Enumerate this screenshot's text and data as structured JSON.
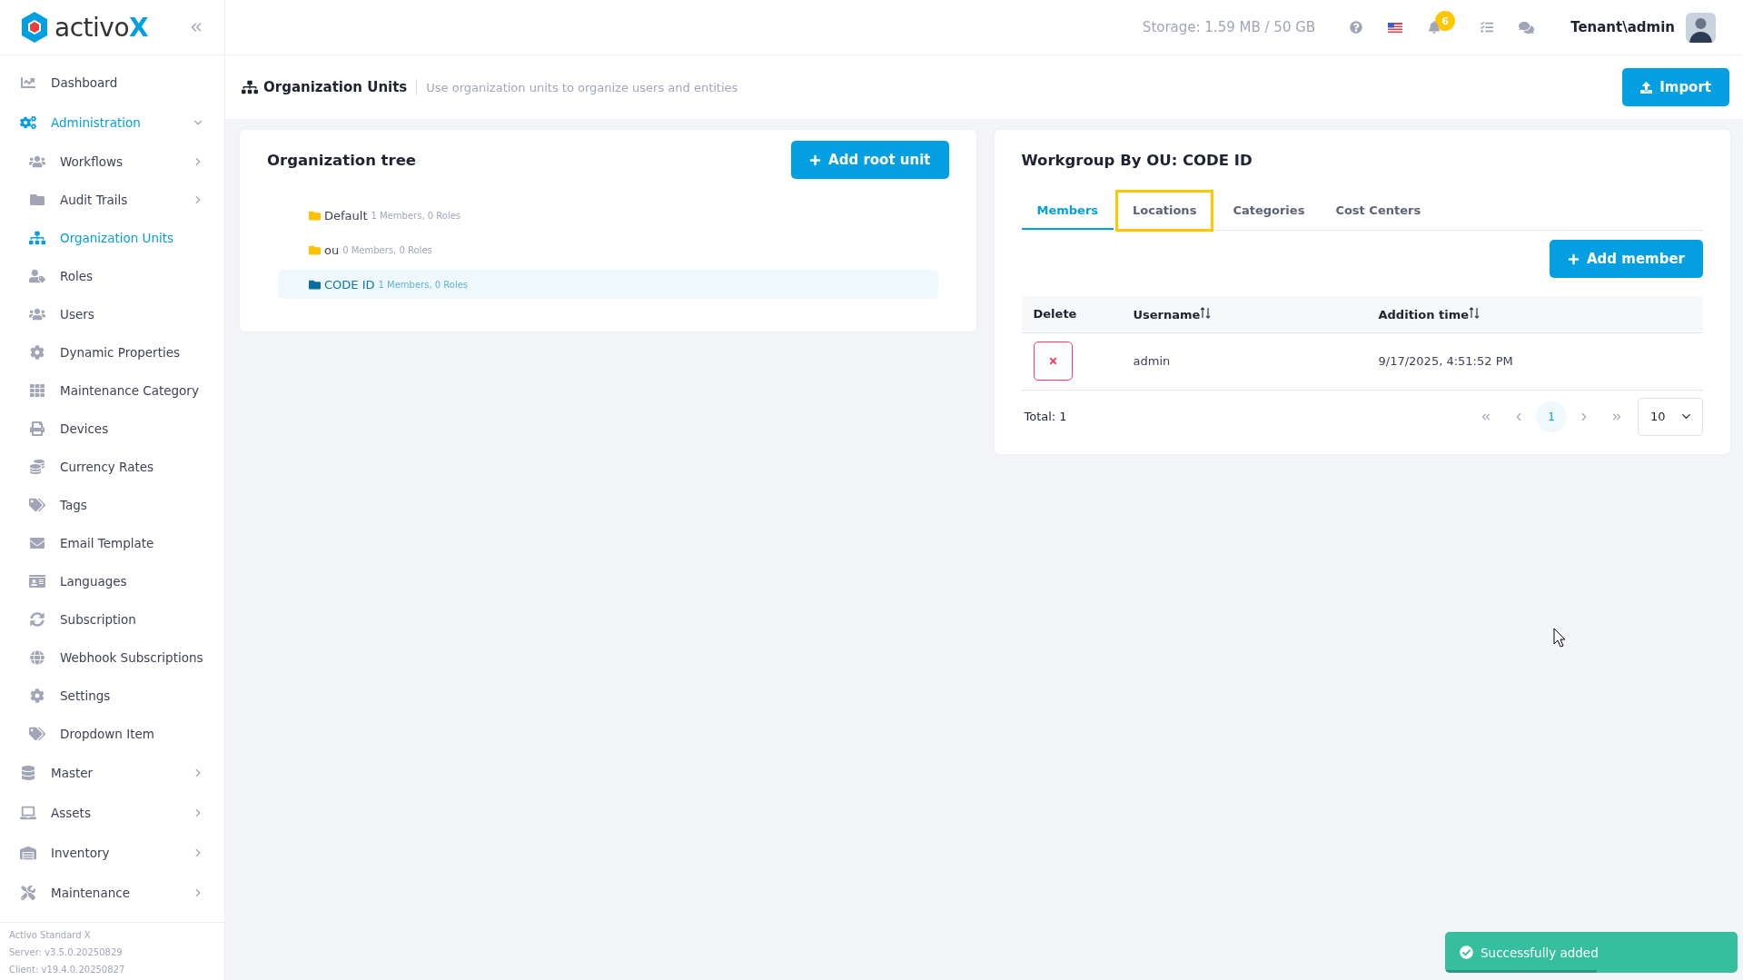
{
  "brand": {
    "name_main": "activo",
    "name_accent": "X"
  },
  "sidebar": {
    "items": [
      {
        "label": "Dashboard",
        "selected": false
      },
      {
        "label": "Administration",
        "selected": true,
        "expanded": true,
        "children": [
          {
            "label": "Workflows",
            "selected": false,
            "expanded": false
          },
          {
            "label": "Audit Trails",
            "selected": false,
            "expanded": false
          },
          {
            "label": "Organization Units",
            "selected": true
          },
          {
            "label": "Roles",
            "selected": false
          },
          {
            "label": "Users",
            "selected": false
          },
          {
            "label": "Dynamic Properties",
            "selected": false
          },
          {
            "label": "Maintenance Category",
            "selected": false
          },
          {
            "label": "Devices",
            "selected": false
          },
          {
            "label": "Currency Rates",
            "selected": false
          },
          {
            "label": "Tags",
            "selected": false
          },
          {
            "label": "Email Template",
            "selected": false
          },
          {
            "label": "Languages",
            "selected": false
          },
          {
            "label": "Subscription",
            "selected": false
          },
          {
            "label": "Webhook Subscriptions",
            "selected": false
          },
          {
            "label": "Settings",
            "selected": false
          },
          {
            "label": "Dropdown Item",
            "selected": false
          }
        ]
      },
      {
        "label": "Master",
        "selected": false,
        "expanded": false
      },
      {
        "label": "Assets",
        "selected": false,
        "expanded": false
      },
      {
        "label": "Inventory",
        "selected": false,
        "expanded": false
      },
      {
        "label": "Maintenance",
        "selected": false,
        "expanded": false
      }
    ],
    "footer": [
      "Activo Standard X",
      "Server: v3.5.0.20250829",
      "Client: v19.4.0.20250827"
    ]
  },
  "topbar": {
    "storage": "Storage: 1.59 MB / 50 GB",
    "notification_count": "6",
    "user": "Tenant\\admin"
  },
  "page_header": {
    "title": "Organization Units",
    "subtitle": "Use organization units to organize users and entities",
    "import_button": "Import"
  },
  "tree_panel": {
    "title": "Organization tree",
    "add_button": "Add root unit",
    "units": [
      {
        "name": "Default",
        "info": "1 Members, 0 Roles",
        "selected": false
      },
      {
        "name": "ou",
        "info": "0 Members, 0 Roles",
        "selected": false
      },
      {
        "name": "CODE ID",
        "info": "1 Members, 0 Roles",
        "selected": true
      }
    ]
  },
  "workgroup_panel": {
    "title": "Workgroup By OU: CODE ID",
    "tabs": [
      {
        "label": "Members",
        "selected": true,
        "highlighted": false
      },
      {
        "label": "Locations",
        "selected": false,
        "highlighted": true
      },
      {
        "label": "Categories",
        "selected": false,
        "highlighted": false
      },
      {
        "label": "Cost Centers",
        "selected": false,
        "highlighted": false
      }
    ],
    "add_button": "Add member",
    "table": {
      "columns": [
        {
          "label": "Delete",
          "sortable": false
        },
        {
          "label": "Username",
          "sortable": true
        },
        {
          "label": "Addition time",
          "sortable": true
        }
      ],
      "rows": [
        {
          "username": "admin",
          "addition_time": "9/17/2025, 4:51:52 PM"
        }
      ]
    },
    "total": "Total: 1",
    "pages": [
      {
        "label": "1",
        "selected": true
      }
    ],
    "page_size": "10"
  },
  "toast": {
    "message": "Successfully added",
    "level": 0.52
  }
}
